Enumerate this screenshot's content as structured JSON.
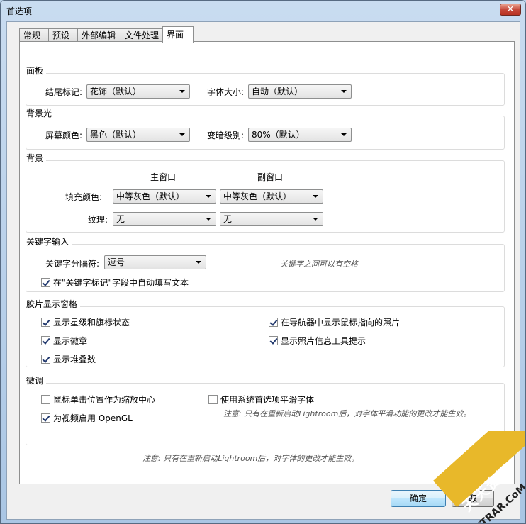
{
  "window": {
    "title": "首选项",
    "close_label": "✕"
  },
  "tabs": [
    {
      "label": "常规"
    },
    {
      "label": "预设"
    },
    {
      "label": "外部编辑"
    },
    {
      "label": "文件处理"
    },
    {
      "label": "界面",
      "active": true
    }
  ],
  "panel": {
    "title": "面板",
    "end_marks_label": "结尾标记:",
    "end_marks_value": "花饰（默认）",
    "font_size_label": "字体大小:",
    "font_size_value": "自动（默认）"
  },
  "lights_out": {
    "title": "背景光",
    "screen_color_label": "屏幕颜色:",
    "screen_color_value": "黑色（默认）",
    "dim_level_label": "变暗级别:",
    "dim_level_value": "80%（默认）"
  },
  "background": {
    "title": "背景",
    "main_window_header": "主窗口",
    "secondary_window_header": "副窗口",
    "fill_color_label": "填充颜色:",
    "main_fill_value": "中等灰色（默认）",
    "secondary_fill_value": "中等灰色（默认）",
    "texture_label": "纹理:",
    "main_texture_value": "无",
    "secondary_texture_value": "无"
  },
  "keyword_entry": {
    "title": "关键字输入",
    "separator_label": "关键字分隔符:",
    "separator_value": "逗号",
    "separator_hint": "关键字之间可以有空格",
    "autofill_label": "在\"关键字标记\"字段中自动填写文本",
    "autofill_checked": true
  },
  "filmstrip": {
    "title": "胶片显示窗格",
    "show_ratings_label": "显示星级和旗标状态",
    "show_badges_label": "显示徽章",
    "show_stack_counts_label": "显示堆叠数",
    "show_navigator_label": "在导航器中显示鼠标指向的照片",
    "show_tooltips_label": "显示照片信息工具提示"
  },
  "tweaks": {
    "title": "微调",
    "zoom_click_label": "鼠标单击位置作为缩放中心",
    "zoom_click_checked": false,
    "opengl_label": "为视频启用 OpenGL",
    "opengl_checked": true,
    "smooth_fonts_label": "使用系统首选项平滑字体",
    "smooth_fonts_checked": false,
    "smooth_fonts_note": "注意: 只有在重新启动Lightroom后，对字体平滑功能的更改才能生效。"
  },
  "footer_note": "注意: 只有在重新启动Lightroom后，对字体的更改才能生效。",
  "buttons": {
    "ok": "确定",
    "cancel": "取"
  },
  "watermark": {
    "top_text": "天天资讯",
    "bottom_text": "TTRAR.CoM"
  }
}
